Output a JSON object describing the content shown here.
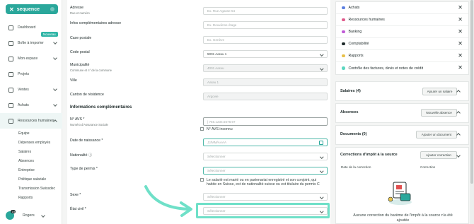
{
  "brand": {
    "name": "sequence"
  },
  "sidebar": {
    "items": [
      {
        "label": "Dashboard"
      },
      {
        "label": "Boîte à importer",
        "badge": "Nouveau"
      },
      {
        "label": "Mon espace"
      },
      {
        "label": "Projets"
      },
      {
        "label": "Ventes"
      },
      {
        "label": "Achats"
      },
      {
        "label": "Ressources humaines"
      }
    ],
    "subitems": [
      "Équipe",
      "Dépenses employés",
      "Salaires",
      "Absences",
      "Entreprise",
      "Politique salariale",
      "Transmission Swissdec",
      "Rapports"
    ],
    "user": {
      "name": "Rogers",
      "count": "19"
    }
  },
  "form": {
    "address": {
      "label": "Adresse",
      "sub": "Rue et numéro",
      "placeholder": "Ex. Rue Agasse 54"
    },
    "address_extra": {
      "label": "Infos complémentaires adresse",
      "placeholder": "Ex. Deuxième étage"
    },
    "po_box": {
      "label": "Case postale",
      "placeholder": "Ex. Genève"
    },
    "postal_code": {
      "label": "Code postal",
      "value": "5001 Aarau 1"
    },
    "municipality": {
      "label": "Municipalité",
      "sub": "Commune et n° de la commune",
      "value": "4001 Aarau"
    },
    "city": {
      "label": "Ville",
      "value": "Aarau 1"
    },
    "canton": {
      "label": "Canton de résidence",
      "value": "Argovie"
    },
    "section_title": "Informations complémentaires",
    "avs": {
      "label": "N° AVS *",
      "sub": "Numéro d'Assurance Sociale",
      "placeholder": "|   756.1234.5678.97",
      "unknown_label": "N° AVS inconnu"
    },
    "birthdate": {
      "label": "Date de naissance *",
      "placeholder": "JJ/MM/AAAA"
    },
    "nationality": {
      "label": "Nationalité ⓘ",
      "placeholder": "Sélectionner"
    },
    "permit": {
      "label": "Type de permis *",
      "placeholder": "Sélectionner",
      "note": "Le salarié est marié ou en partenariat enregistré et son conjoint, qui habite en Suisse, est de nationalité suisse ou est titulaire du permis C"
    },
    "sex": {
      "label": "Sexe *",
      "placeholder": "Sélectionner"
    },
    "civil_status": {
      "label": "État civil *",
      "placeholder": "Sélectionner"
    }
  },
  "tags": [
    {
      "label": "Achats",
      "color": "#5b7fe0"
    },
    {
      "label": "Ressources humaines",
      "color": "#e05b8c"
    },
    {
      "label": "Banking",
      "color": "#c05bd6"
    },
    {
      "label": "Comptabilité",
      "color": "#1e2a2a"
    },
    {
      "label": "Rapports",
      "color": "#e8c14a"
    },
    {
      "label": "Contrôle des factures, devis et notes de crédit",
      "color": "#5bd6c0"
    }
  ],
  "panels": {
    "salaries": {
      "title": "Salaires (4)",
      "button": "Ajouter un salaire"
    },
    "absences": {
      "title": "Absences",
      "button": "Nouvelle absence"
    },
    "documents": {
      "title": "Documents (0)",
      "button": "Ajouter un document"
    },
    "tax": {
      "title": "Corrections d'impôt à la source",
      "button": "Ajouter correction",
      "col_date": "Date de la correction",
      "col_corr": "Correction",
      "empty": "Aucune correction du barème de l'impôt à la source n'a été ajoutée"
    }
  },
  "colors": {
    "brand": "#2aa79b",
    "highlight": "#6fe0c8"
  }
}
